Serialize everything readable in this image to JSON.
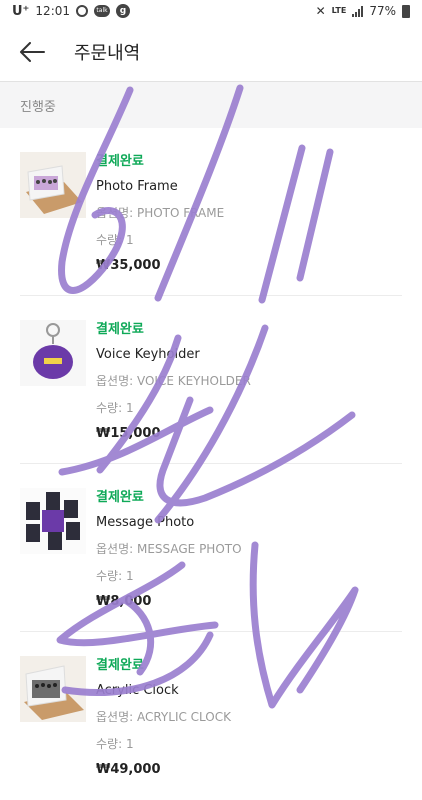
{
  "status_bar": {
    "carrier": "U⁺",
    "time": "12:01",
    "network": "LTE",
    "battery": "77%"
  },
  "header": {
    "title": "주문내역"
  },
  "section": {
    "label": "진행중"
  },
  "orders": [
    {
      "status": "결제완료",
      "name": "Photo Frame",
      "option": "옵션명: PHOTO FRAME",
      "qty": "수량: 1",
      "price": "₩35,000"
    },
    {
      "status": "결제완료",
      "name": "Voice Keyholder",
      "option": "옵션명: VOICE KEYHOLDER",
      "qty": "수량: 1",
      "price": "₩15,000"
    },
    {
      "status": "결제완료",
      "name": "Message Photo",
      "option": "옵션명: MESSAGE PHOTO",
      "qty": "수량: 1",
      "price": "₩8,000"
    },
    {
      "status": "결제완료",
      "name": "Acrylic Clock",
      "option": "옵션명: ACRYLIC CLOCK",
      "qty": "수량: 1",
      "price": "₩49,000"
    }
  ],
  "colors": {
    "status_green": "#0fa958",
    "scribble": "#9b7fd0"
  }
}
